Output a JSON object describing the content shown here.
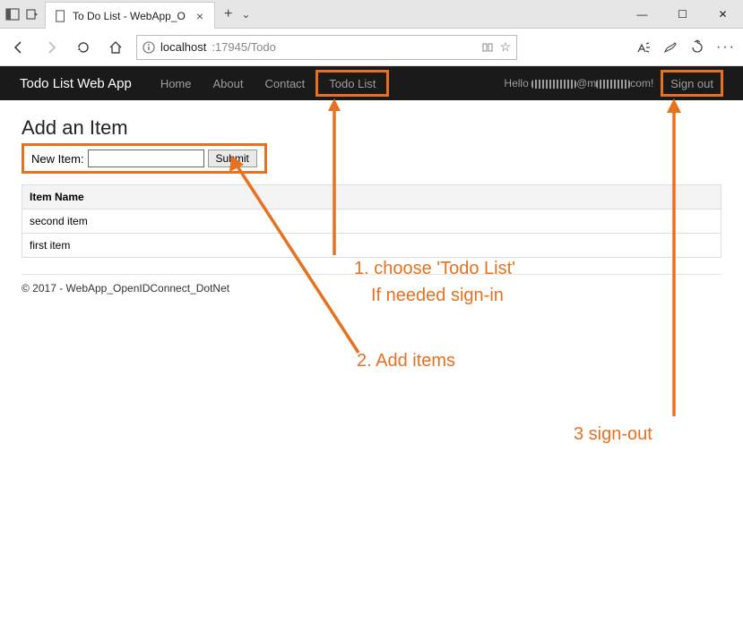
{
  "window": {
    "tab_title": "To Do List - WebApp_O",
    "minimize_glyph": "—",
    "maximize_glyph": "☐",
    "close_glyph": "✕",
    "newtab_glyph": "+",
    "caret_glyph": "⌄"
  },
  "address": {
    "host": "localhost",
    "rest": ":17945/Todo"
  },
  "navbar": {
    "brand": "Todo List Web App",
    "links": [
      "Home",
      "About",
      "Contact",
      "Todo List"
    ],
    "greeting_prefix": "Hello ",
    "greeting_mid_visible": "@m",
    "greeting_suffix": "com!",
    "signout": "Sign out"
  },
  "page": {
    "heading": "Add an Item",
    "new_item_label": "New Item:",
    "submit_label": "Submit",
    "table_header": "Item Name",
    "rows": [
      "second item",
      "first item"
    ],
    "footer": "© 2017 - WebApp_OpenIDConnect_DotNet"
  },
  "annotations": {
    "step1_line1": "1. choose 'Todo List'",
    "step1_line2": "If needed sign-in",
    "step2": "2. Add items",
    "step3": "3 sign-out"
  }
}
